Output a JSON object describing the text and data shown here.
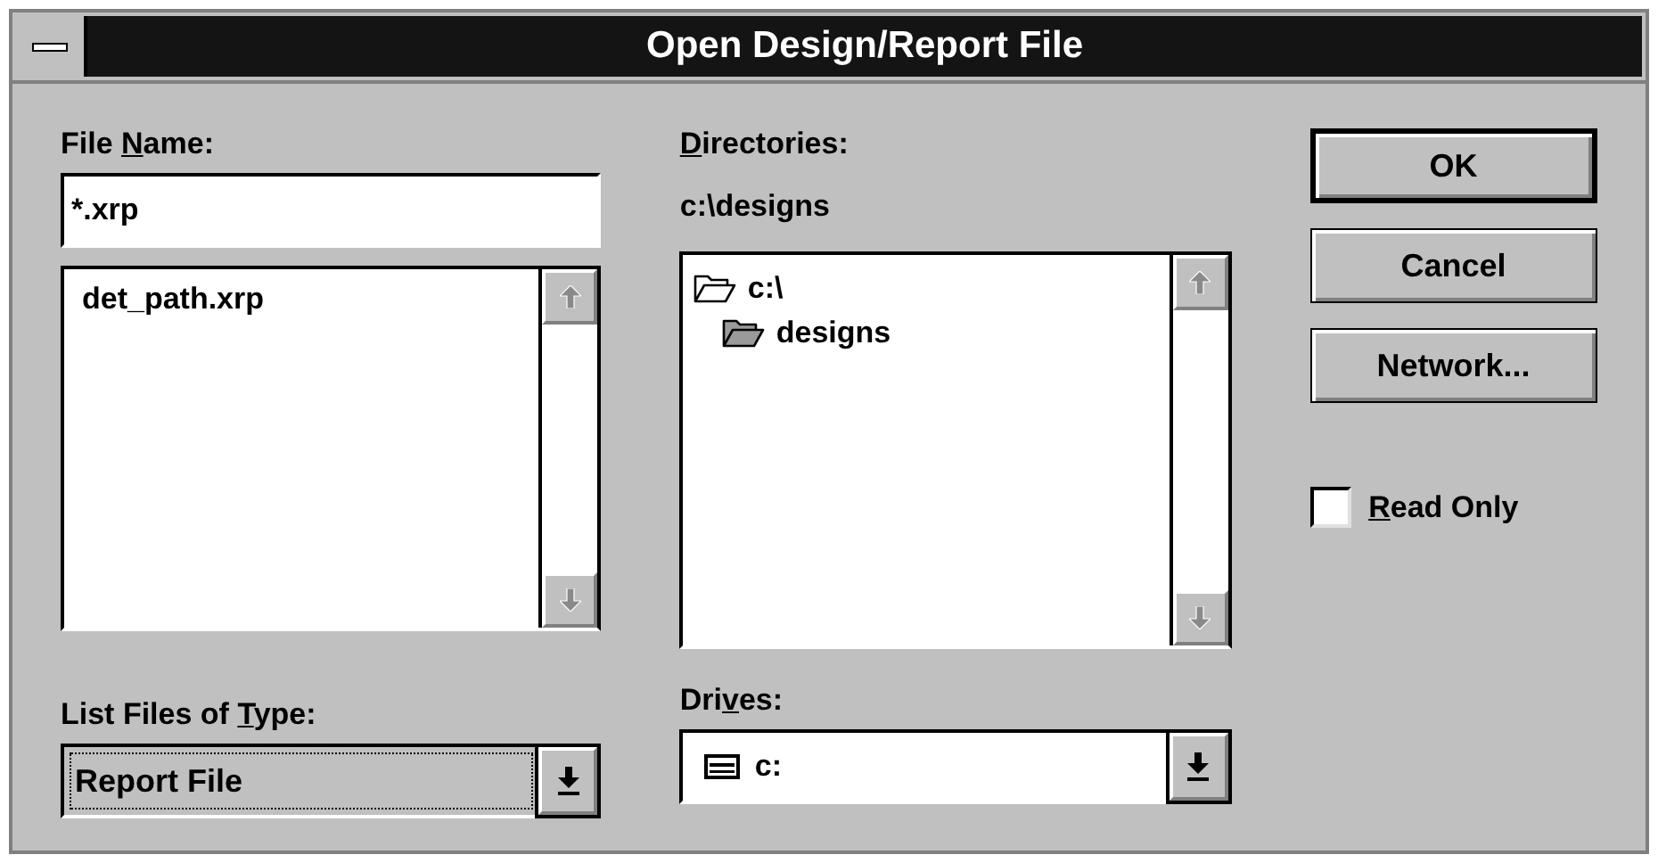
{
  "window": {
    "title": "Open Design/Report File"
  },
  "file_name": {
    "label_parts": {
      "before": "File ",
      "key": "N",
      "after": "ame:"
    },
    "value": "*.xrp"
  },
  "files": {
    "items": [
      {
        "name": "det_path.xrp",
        "selected": false
      }
    ]
  },
  "file_type": {
    "label_parts": {
      "before": "List Files of ",
      "key": "T",
      "after": "ype:"
    },
    "value": "Report File",
    "focused": true
  },
  "directories": {
    "label_parts": {
      "key": "D",
      "after": "irectories:"
    },
    "path": "c:\\designs",
    "tree": [
      {
        "name": "c:\\",
        "current": false,
        "children": [
          {
            "name": "designs",
            "current": true
          }
        ]
      }
    ]
  },
  "drives": {
    "label_parts": {
      "before": "Dri",
      "key": "v",
      "after": "es:"
    },
    "value": "c:"
  },
  "buttons": [
    {
      "label": "OK",
      "default": true
    },
    {
      "label": "Cancel",
      "default": false
    },
    {
      "label": "Network...",
      "default": false
    }
  ],
  "read_only": {
    "label_parts": {
      "key": "R",
      "after": "ead Only"
    },
    "checked": false
  }
}
